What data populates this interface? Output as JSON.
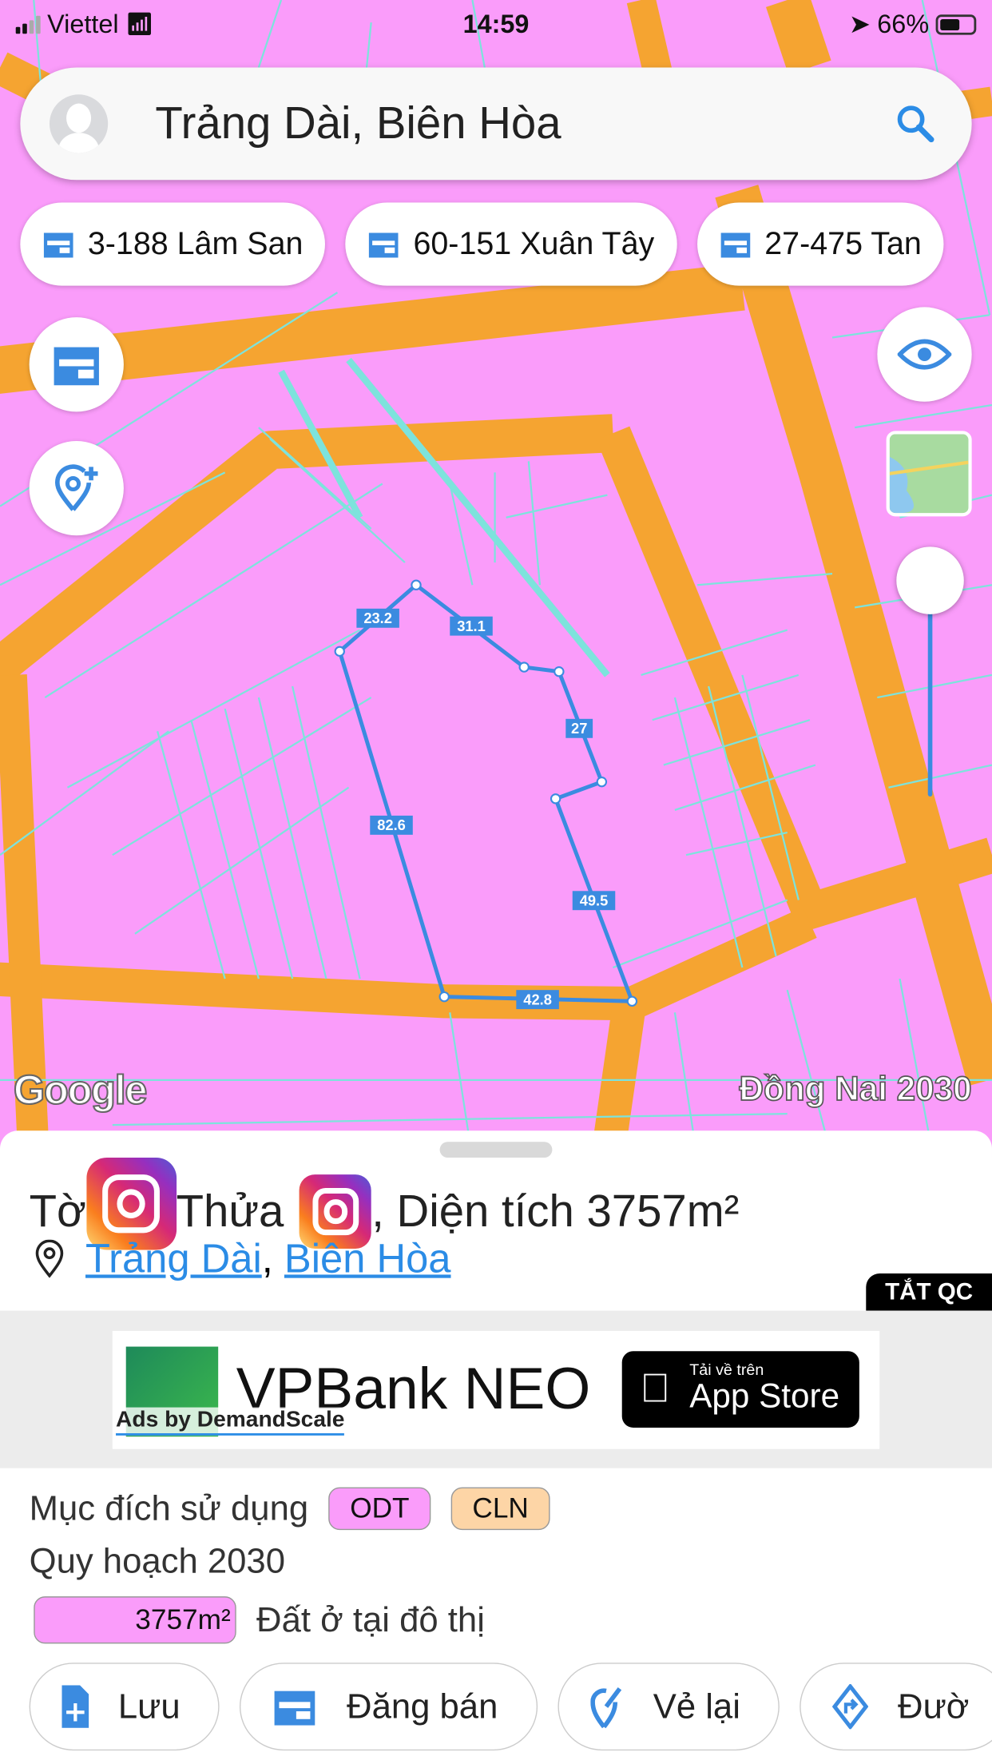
{
  "status_bar": {
    "carrier": "Viettel",
    "time": "14:59",
    "battery": "66%",
    "battery_level": 0.66
  },
  "search": {
    "value": "Trảng Dài, Biên Hòa"
  },
  "chips": [
    {
      "label": "3-188 Lâm San"
    },
    {
      "label": "60-151 Xuân Tây"
    },
    {
      "label": "27-475 Tan"
    }
  ],
  "map": {
    "attribution": "Google",
    "layer_name": "Đồng Nai 2030",
    "colors": {
      "land": "#fa9cfa",
      "road": "#f5a431",
      "parcel_line": "#7de3dc",
      "boundary": "#3b8be0"
    },
    "edge_lengths": [
      "23.2",
      "31.1",
      "27",
      "82.6",
      "49.5",
      "42.8"
    ]
  },
  "sheet": {
    "title_prefix": "Tờ",
    "title_mid": "Thửa",
    "title_suffix": ", Diện tích 3757m²",
    "location": {
      "ward": "Trảng Dài",
      "sep": ",",
      "city": "Biên Hòa"
    },
    "ad_close": "TẮT QC",
    "ad": {
      "brand": "VPBank NEO",
      "ads_by": "Ads by DemandScale",
      "store_small": "Tải về trên",
      "store_big": "App Store"
    },
    "usage_label": "Mục đích sử dụng",
    "usage_tags": [
      {
        "code": "ODT",
        "color": "#fa9cfa"
      },
      {
        "code": "CLN",
        "color": "#fdd5a6"
      }
    ],
    "plan_label": "Quy hoạch 2030",
    "plan_area": "3757m²",
    "plan_desc": "Đất ở tại đô thị",
    "actions": [
      {
        "label": "Lưu"
      },
      {
        "label": "Đăng bán"
      },
      {
        "label": "Vẻ lại"
      },
      {
        "label": "Đườ"
      }
    ]
  }
}
